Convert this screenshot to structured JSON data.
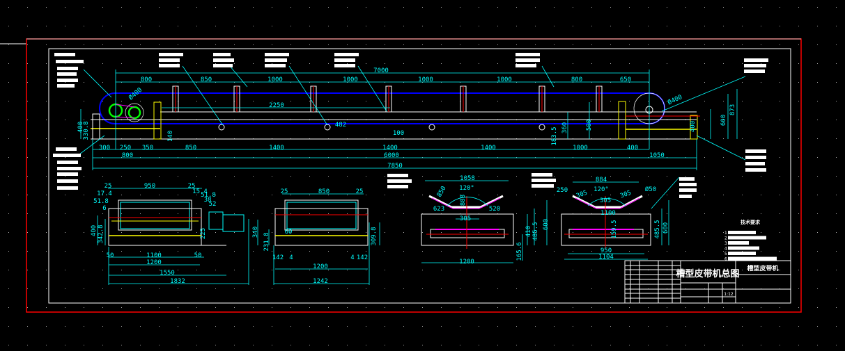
{
  "drawing": {
    "title": "槽型皮带机总图",
    "name": "槽型皮带机",
    "scale": "1:12",
    "notes_heading": "技术要求",
    "notes_numbers": [
      "1",
      "2",
      "3",
      "4",
      "5",
      "6"
    ]
  },
  "colors": {
    "background": "#000000",
    "dimension": "#00ffff",
    "belt": "#0000ff",
    "outline": "#ffffff",
    "frame_border": "#ff0000",
    "support": "#ffff00",
    "centerline": "#ff0000",
    "roller": "#ff00ff",
    "drive_pulley": "#00ff00"
  },
  "main_view": {
    "dimensions": [
      "7000",
      "800",
      "850",
      "1000",
      "1000",
      "1000",
      "1000",
      "800",
      "650",
      "2250",
      "Ø400",
      "Ø400",
      "400",
      "330.8",
      "140",
      "482",
      "100",
      "360",
      "183.5",
      "500",
      "400",
      "600",
      "873",
      "300",
      "250",
      "350",
      "850",
      "1400",
      "1400",
      "1400",
      "1000",
      "400",
      "800",
      "6000",
      "1050",
      "7850"
    ]
  },
  "drive_end_view": {
    "dimensions": [
      "25",
      "950",
      "25",
      "17.4",
      "15.4",
      "51.8",
      "51.8",
      "38",
      "52",
      "6",
      "400",
      "342.8",
      "225",
      "340",
      "50",
      "1100",
      "50",
      "1200",
      "1550",
      "1832"
    ]
  },
  "tail_end_view": {
    "dimensions": [
      "25",
      "850",
      "25",
      "231.8",
      "60",
      "309.8",
      "142",
      "4",
      "4",
      "142",
      "1200",
      "1242"
    ]
  },
  "carrying_idler_view": {
    "dimensions": [
      "1058",
      "120°",
      "850",
      "888",
      "623",
      "520",
      "305",
      "410",
      "485.5",
      "600",
      "165.6",
      "1200"
    ]
  },
  "return_idler_view": {
    "dimensions": [
      "884",
      "120°",
      "250",
      "Ø50",
      "305",
      "305",
      "305",
      "1100",
      "159.5",
      "485.5",
      "600",
      "950",
      "1104"
    ]
  }
}
